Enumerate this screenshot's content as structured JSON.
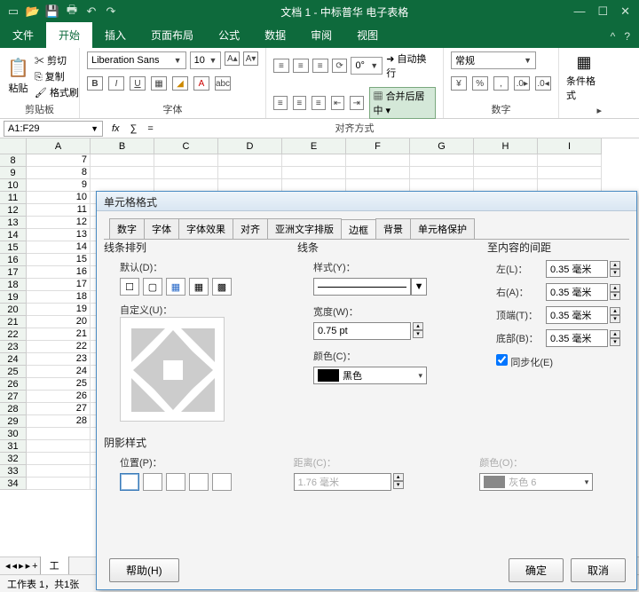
{
  "titlebar": {
    "title": "文档 1 - 中标普华 电子表格"
  },
  "menubar": {
    "tabs": [
      "文件",
      "开始",
      "插入",
      "页面布局",
      "公式",
      "数据",
      "审阅",
      "视图"
    ],
    "active": 1
  },
  "ribbon": {
    "clipboard": {
      "paste": "粘贴",
      "cut": "剪切",
      "copy": "复制",
      "formatPainter": "格式刷",
      "label": "剪贴板"
    },
    "font": {
      "family": "Liberation Sans",
      "size": "10",
      "label": "字体",
      "bold": "B",
      "italic": "I",
      "underline": "U"
    },
    "align": {
      "label": "对齐方式",
      "rotate": "0°",
      "wrap": "自动换行",
      "merge": "合并后居中"
    },
    "number": {
      "label": "数字",
      "format": "常规"
    },
    "cond": {
      "label": "条件格式"
    }
  },
  "formula": {
    "ref": "A1:F29",
    "fx": "fx",
    "sigma": "∑",
    "eq": "="
  },
  "sheet": {
    "cols": [
      "A",
      "B",
      "C",
      "D",
      "E",
      "F",
      "G",
      "H",
      "I"
    ],
    "startRow": 8,
    "endRow": 34,
    "avals": {
      "8": "7",
      "9": "8",
      "10": "9",
      "11": "10",
      "12": "11",
      "13": "12",
      "14": "13",
      "15": "14",
      "16": "15",
      "17": "16",
      "18": "17",
      "19": "18",
      "20": "19",
      "21": "20",
      "22": "21",
      "23": "22",
      "24": "23",
      "25": "24",
      "26": "25",
      "27": "26",
      "28": "27",
      "29": "28"
    }
  },
  "tabs": {
    "sheet1": "工",
    "nav": [
      "◂",
      "◂",
      "▸",
      "▸",
      "+"
    ]
  },
  "status": {
    "text": "工作表 1，共1张"
  },
  "dialog": {
    "title": "单元格格式",
    "tabs": [
      "数字",
      "字体",
      "字体效果",
      "对齐",
      "亚洲文字排版",
      "边框",
      "背景",
      "单元格保护"
    ],
    "active": 5,
    "lineArr": {
      "label": "线条排列",
      "default": "默认(D)：",
      "custom": "自定义(U)："
    },
    "line": {
      "label": "线条",
      "style": "样式(Y)：",
      "width": "宽度(W)：",
      "widthVal": "0.75 pt",
      "color": "颜色(C)：",
      "colorVal": "黑色"
    },
    "padding": {
      "label": "至内容的间距",
      "left": "左(L)：",
      "right": "右(A)：",
      "top": "顶端(T)：",
      "bottom": "底部(B)：",
      "val": "0.35 毫米",
      "sync": "同步化(E)"
    },
    "shadow": {
      "label": "阴影样式",
      "pos": "位置(P)：",
      "dist": "距离(C)：",
      "distVal": "1.76 毫米",
      "color": "颜色(O)：",
      "colorVal": "灰色 6"
    },
    "buttons": {
      "help": "帮助(H)",
      "ok": "确定",
      "cancel": "取消"
    }
  }
}
